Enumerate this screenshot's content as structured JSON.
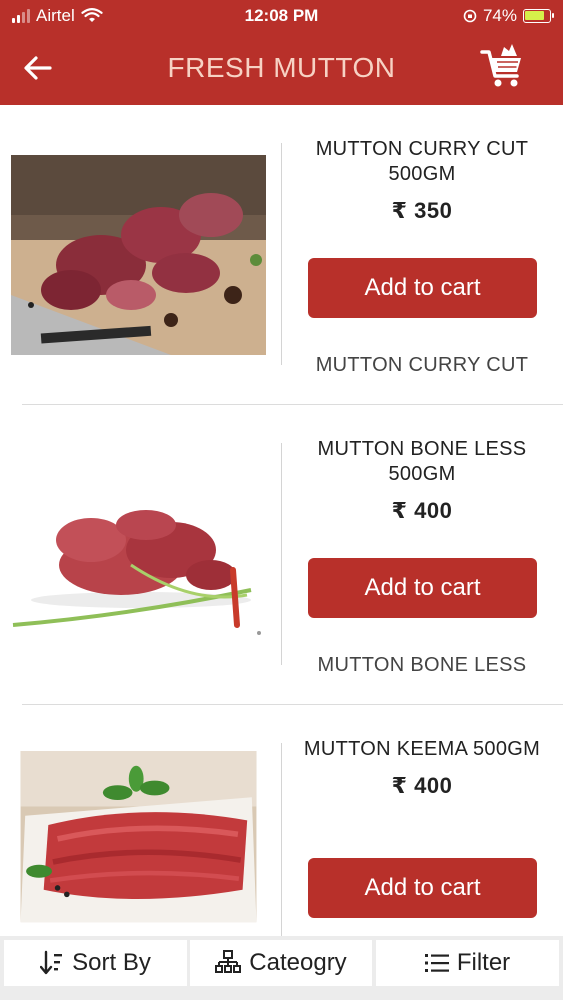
{
  "status_bar": {
    "carrier": "Airtel",
    "time": "12:08 PM",
    "battery": "74%",
    "icons": [
      "signal-icon",
      "wifi-icon",
      "orientation-lock-icon",
      "battery-icon"
    ]
  },
  "header": {
    "title": "FRESH MUTTON",
    "back_icon": "arrow-left-icon",
    "cart_icon": "shopping-cart-icon"
  },
  "products": [
    {
      "name": "MUTTON CURRY CUT 500GM",
      "price": "₹ 350",
      "button": "Add to cart",
      "subtitle": "MUTTON CURRY CUT",
      "image": "mutton-curry-cut-image"
    },
    {
      "name": "MUTTON BONE LESS 500GM",
      "price": "₹ 400",
      "button": "Add to cart",
      "subtitle": "MUTTON BONE LESS",
      "image": "mutton-boneless-image"
    },
    {
      "name": "MUTTON KEEMA 500GM",
      "price": "₹ 400",
      "button": "Add to cart",
      "subtitle": "",
      "image": "mutton-keema-image"
    }
  ],
  "bottom_bar": {
    "sort_label": "Sort By",
    "category_label": "Cateogry",
    "filter_label": "Filter"
  },
  "colors": {
    "primary": "#b8302a",
    "header_text": "#f7d2c4",
    "bottom_bar": "#ececec"
  }
}
